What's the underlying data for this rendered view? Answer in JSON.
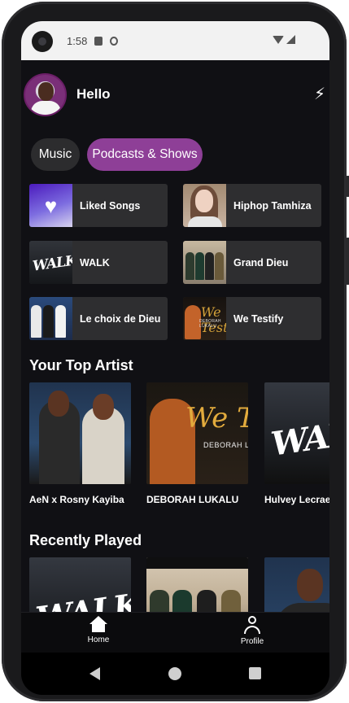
{
  "status_bar": {
    "time": "1:58"
  },
  "header": {
    "greeting": "Hello"
  },
  "filters": [
    {
      "label": "Music",
      "active": false
    },
    {
      "label": "Podcasts & Shows",
      "active": true
    }
  ],
  "shortcuts": [
    {
      "label": "Liked Songs",
      "art": "heart-icon"
    },
    {
      "label": "Hiphop Tamhiza",
      "art": "woman-portrait"
    },
    {
      "label": "WALK",
      "art": "walk-cover"
    },
    {
      "label": "Grand Dieu",
      "art": "group-photo"
    },
    {
      "label": "Le choix de Dieu",
      "art": "group-photo"
    },
    {
      "label": "We Testify",
      "art": "we-testify-cover"
    }
  ],
  "top_artists": {
    "title": "Your Top Artist",
    "items": [
      {
        "label": "AeN x Rosny Kayiba"
      },
      {
        "label": "DEBORAH LUKALU"
      },
      {
        "label": "Hulvey Lecrae"
      }
    ]
  },
  "cover_text": {
    "walk": "WALK",
    "we_testify": "We Testify",
    "deborah": "DEBORAH LUKALU"
  },
  "recently_played": {
    "title": "Recently Played"
  },
  "bottom_nav": [
    {
      "label": "Home",
      "icon": "home-icon"
    },
    {
      "label": "Profile",
      "icon": "profile-icon"
    }
  ],
  "colors": {
    "accent": "#8e3f97",
    "background": "#101014",
    "tile": "#2e2e30"
  }
}
